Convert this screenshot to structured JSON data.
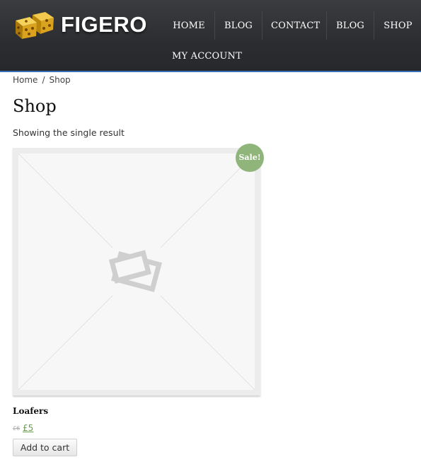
{
  "header": {
    "logo_text": "FIGERO",
    "nav": [
      {
        "label": "HOME"
      },
      {
        "label": "BLOG"
      },
      {
        "label": "CONTACT"
      },
      {
        "label": "BLOG"
      },
      {
        "label": "SHOP"
      },
      {
        "label": "MY ACCOUNT"
      }
    ]
  },
  "breadcrumb": {
    "home": "Home",
    "separator": "/",
    "current": "Shop"
  },
  "page": {
    "title": "Shop",
    "result_count": "Showing the single result"
  },
  "product": {
    "badge": "Sale!",
    "name": "Loafers",
    "price_old": "£6",
    "price_new": "£5",
    "button_label": "Add to cart",
    "image": "placeholder-image-icon"
  },
  "colors": {
    "header_bg": "#2b2d30",
    "header_accent": "#3a6fb5",
    "sale_badge": "#8fb57a",
    "price": "#6a9a4f"
  }
}
